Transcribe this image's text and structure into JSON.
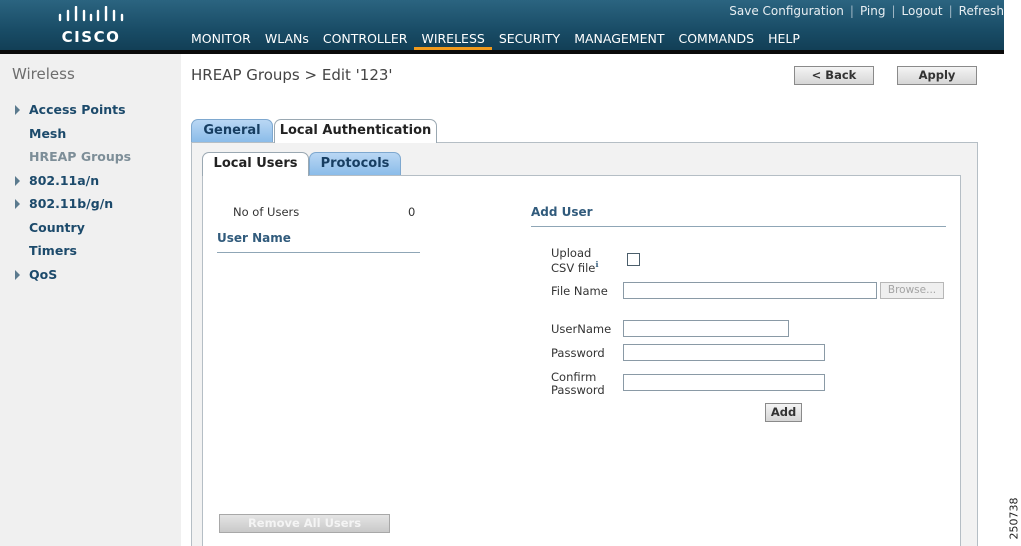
{
  "brand": {
    "logo_text": "CISCO"
  },
  "utility_links": [
    "Save Configuration",
    "Ping",
    "Logout",
    "Refresh"
  ],
  "nav": [
    {
      "label": "MONITOR",
      "active": false
    },
    {
      "label": "WLANs",
      "active": false
    },
    {
      "label": "CONTROLLER",
      "active": false
    },
    {
      "label": "WIRELESS",
      "active": true
    },
    {
      "label": "SECURITY",
      "active": false
    },
    {
      "label": "MANAGEMENT",
      "active": false
    },
    {
      "label": "COMMANDS",
      "active": false
    },
    {
      "label": "HELP",
      "active": false
    }
  ],
  "sidebar": {
    "title": "Wireless",
    "items": [
      {
        "label": "Access Points",
        "expandable": true,
        "current": false
      },
      {
        "label": "Mesh",
        "expandable": false,
        "current": false
      },
      {
        "label": "HREAP Groups",
        "expandable": false,
        "current": true
      },
      {
        "label": "802.11a/n",
        "expandable": true,
        "current": false
      },
      {
        "label": "802.11b/g/n",
        "expandable": true,
        "current": false
      },
      {
        "label": "Country",
        "expandable": false,
        "current": false
      },
      {
        "label": "Timers",
        "expandable": false,
        "current": false
      },
      {
        "label": "QoS",
        "expandable": true,
        "current": false
      }
    ]
  },
  "page": {
    "title": "HREAP Groups > Edit   '123'",
    "back_label": "< Back",
    "apply_label": "Apply"
  },
  "tabs": {
    "outer": [
      "General",
      "Local Authentication"
    ],
    "inner": [
      "Local Users",
      "Protocols"
    ]
  },
  "users": {
    "count_label": "No of Users",
    "count_value": "0",
    "column_header": "User Name",
    "remove_all_label": "Remove All Users"
  },
  "add_user": {
    "heading": "Add User",
    "upload_label_line1": "Upload",
    "upload_label_line2": "CSV file",
    "upload_checked": false,
    "file_name_label": "File Name",
    "file_name_value": "",
    "browse_label": "Browse...",
    "username_label": "UserName",
    "username_value": "",
    "password_label": "Password",
    "password_value": "",
    "confirm_label_line1": "Confirm",
    "confirm_label_line2": "Password",
    "confirm_value": "",
    "add_label": "Add"
  },
  "figure_id": "250738",
  "colors": {
    "header": "#194c66",
    "active_nav_underline": "#f19a1c",
    "sidebar_link": "#1c4a6b",
    "tab_blue": "#8bbce9"
  }
}
